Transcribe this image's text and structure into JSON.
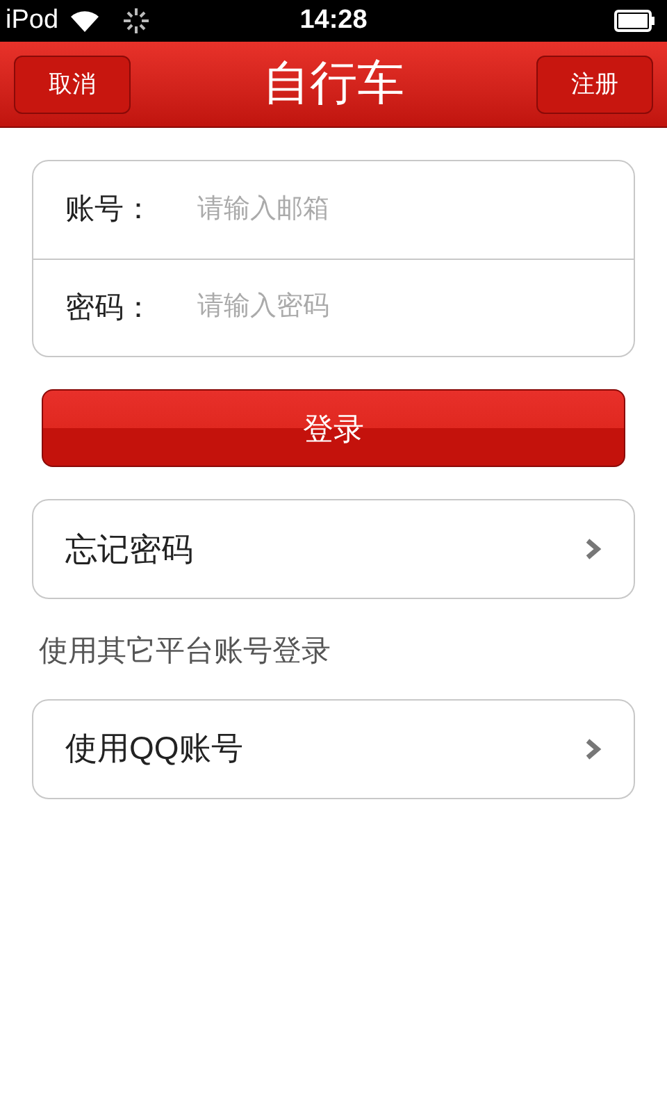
{
  "status_bar": {
    "carrier": "iPod",
    "time": "14:28"
  },
  "nav_bar": {
    "left_button": "取消",
    "title": "自行车",
    "right_button": "注册"
  },
  "form": {
    "fields": [
      {
        "label": "账号：",
        "placeholder": "请输入邮箱"
      },
      {
        "label": "密码：",
        "placeholder": "请输入密码"
      }
    ]
  },
  "login_button": "登录",
  "forgot_row": {
    "label": "忘记密码"
  },
  "other_login_heading": "使用其它平台账号登录",
  "other_logins": [
    {
      "label": "使用QQ账号"
    }
  ]
}
